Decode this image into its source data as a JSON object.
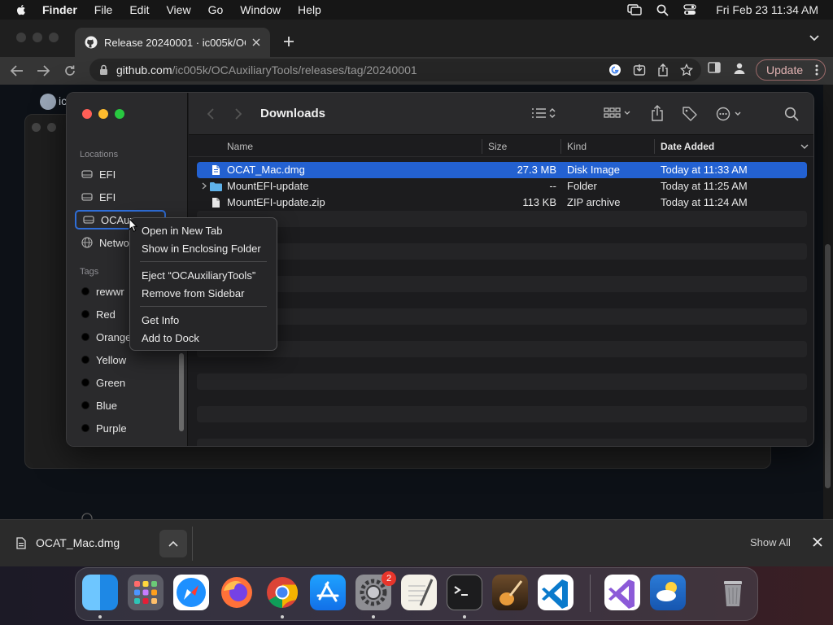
{
  "menubar": {
    "app": "Finder",
    "items": [
      "File",
      "Edit",
      "View",
      "Go",
      "Window",
      "Help"
    ],
    "clock": "Fri Feb 23  11:34 AM"
  },
  "browser": {
    "tab_title": "Release 20240001 · ic005k/OC",
    "url_host": "github.com",
    "url_path": "/ic005k/OCAuxiliaryTools/releases/tag/20240001",
    "update_label": "Update",
    "page_user": "ic"
  },
  "finder": {
    "title": "Downloads",
    "sidebar": {
      "locations_label": "Locations",
      "locations": [
        "EFI",
        "EFI",
        "OCAux",
        "Netwo"
      ],
      "tags_label": "Tags",
      "tags": [
        {
          "name": "rewwr",
          "color": "#000000"
        },
        {
          "name": "Red",
          "color": "#000000"
        },
        {
          "name": "Orange",
          "color": "#000000"
        },
        {
          "name": "Yellow",
          "color": "#000000"
        },
        {
          "name": "Green",
          "color": "#000000"
        },
        {
          "name": "Blue",
          "color": "#000000"
        },
        {
          "name": "Purple",
          "color": "#000000"
        }
      ]
    },
    "columns": {
      "name": "Name",
      "size": "Size",
      "kind": "Kind",
      "date": "Date Added"
    },
    "files": [
      {
        "name": "OCAT_Mac.dmg",
        "size": "27.3 MB",
        "kind": "Disk Image",
        "date": "Today at 11:33 AM"
      },
      {
        "name": "MountEFI-update",
        "size": "--",
        "kind": "Folder",
        "date": "Today at 11:25 AM"
      },
      {
        "name": "MountEFI-update.zip",
        "size": "113 KB",
        "kind": "ZIP archive",
        "date": "Today at 11:24 AM"
      }
    ]
  },
  "context_menu": {
    "group1": [
      "Open in New Tab",
      "Show in Enclosing Folder"
    ],
    "group2": [
      "Eject “OCAuxiliaryTools”",
      "Remove from Sidebar"
    ],
    "group3": [
      "Get Info",
      "Add to Dock"
    ]
  },
  "downloads_bar": {
    "file": "OCAT_Mac.dmg",
    "show_all": "Show All"
  },
  "dock": {
    "settings_badge": "2"
  },
  "colors": {
    "accent": "#2361d1",
    "selection_outline": "#2f6ed8"
  }
}
